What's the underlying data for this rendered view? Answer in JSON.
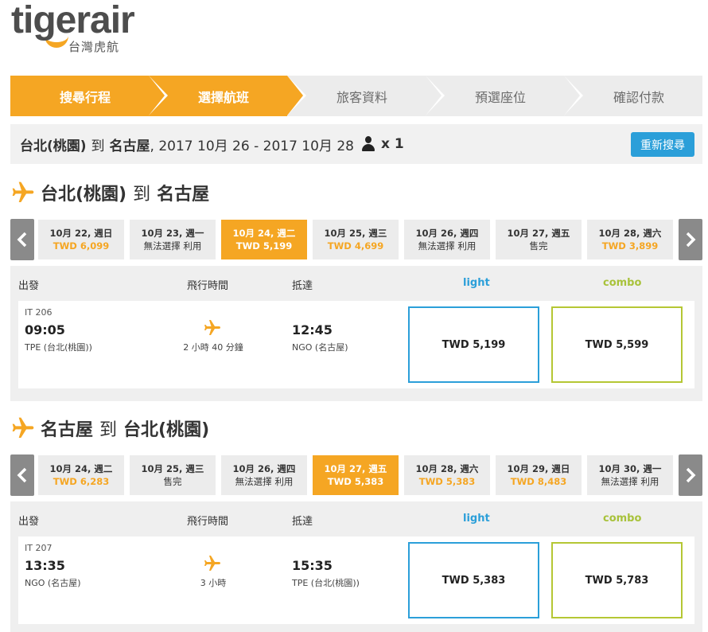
{
  "logo": {
    "brand": "tigerair",
    "sub": "台灣虎航"
  },
  "steps": [
    {
      "label": "搜尋行程"
    },
    {
      "label": "選擇航班"
    },
    {
      "label": "旅客資料"
    },
    {
      "label": "預選座位"
    },
    {
      "label": "確認付款"
    }
  ],
  "summary": {
    "origin": "台北(桃園)",
    "to": "到",
    "destination": "名古屋",
    "dates": ", 2017 10月 26 - 2017 10月 28",
    "passengers": "x 1",
    "research_label": "重新搜尋"
  },
  "outbound": {
    "origin": "台北(桃園)",
    "to": "到",
    "destination": "名古屋",
    "dates": [
      {
        "date": "10月 22, 週日",
        "info": "TWD 6,099",
        "kind": "price"
      },
      {
        "date": "10月 23, 週一",
        "info": "無法選擇 利用",
        "kind": "text"
      },
      {
        "date": "10月 24, 週二",
        "info": "TWD 5,199",
        "kind": "price",
        "selected": true
      },
      {
        "date": "10月 25, 週三",
        "info": "TWD 4,699",
        "kind": "price"
      },
      {
        "date": "10月 26, 週四",
        "info": "無法選擇 利用",
        "kind": "text"
      },
      {
        "date": "10月 27, 週五",
        "info": "售完",
        "kind": "text"
      },
      {
        "date": "10月 28, 週六",
        "info": "TWD 3,899",
        "kind": "price"
      }
    ],
    "headers": {
      "depart": "出發",
      "duration": "飛行時間",
      "arrive": "抵達",
      "light": "light",
      "combo": "combo"
    },
    "flight": {
      "number": "IT 206",
      "dep_time": "09:05",
      "dep_airport": "TPE (台北(桃園))",
      "duration": "2 小時 40 分鐘",
      "arr_time": "12:45",
      "arr_airport": "NGO (名古屋)",
      "light_fare": "TWD 5,199",
      "combo_fare": "TWD 5,599"
    }
  },
  "inbound": {
    "origin": "名古屋",
    "to": "到",
    "destination": "台北(桃園)",
    "dates": [
      {
        "date": "10月 24, 週二",
        "info": "TWD 6,283",
        "kind": "price"
      },
      {
        "date": "10月 25, 週三",
        "info": "售完",
        "kind": "text"
      },
      {
        "date": "10月 26, 週四",
        "info": "無法選擇 利用",
        "kind": "text"
      },
      {
        "date": "10月 27, 週五",
        "info": "TWD 5,383",
        "kind": "price",
        "selected": true
      },
      {
        "date": "10月 28, 週六",
        "info": "TWD 5,383",
        "kind": "price"
      },
      {
        "date": "10月 29, 週日",
        "info": "TWD 8,483",
        "kind": "price"
      },
      {
        "date": "10月 30, 週一",
        "info": "無法選擇 利用",
        "kind": "text"
      }
    ],
    "headers": {
      "depart": "出發",
      "duration": "飛行時間",
      "arrive": "抵達",
      "light": "light",
      "combo": "combo"
    },
    "flight": {
      "number": "IT 207",
      "dep_time": "13:35",
      "dep_airport": "NGO (名古屋)",
      "duration": "3 小時",
      "arr_time": "15:35",
      "arr_airport": "TPE (台北(桃園))",
      "light_fare": "TWD 5,383",
      "combo_fare": "TWD 5,783"
    }
  },
  "colors": {
    "brand_orange": "#f5a623",
    "light_blue": "#2b9fd9",
    "combo_green": "#b5c734",
    "step_inactive": "#ececec"
  },
  "icons": {
    "section": "airplane-icon",
    "nav_prev": "chevron-left-icon",
    "nav_next": "chevron-right-icon",
    "passenger": "person-icon"
  }
}
